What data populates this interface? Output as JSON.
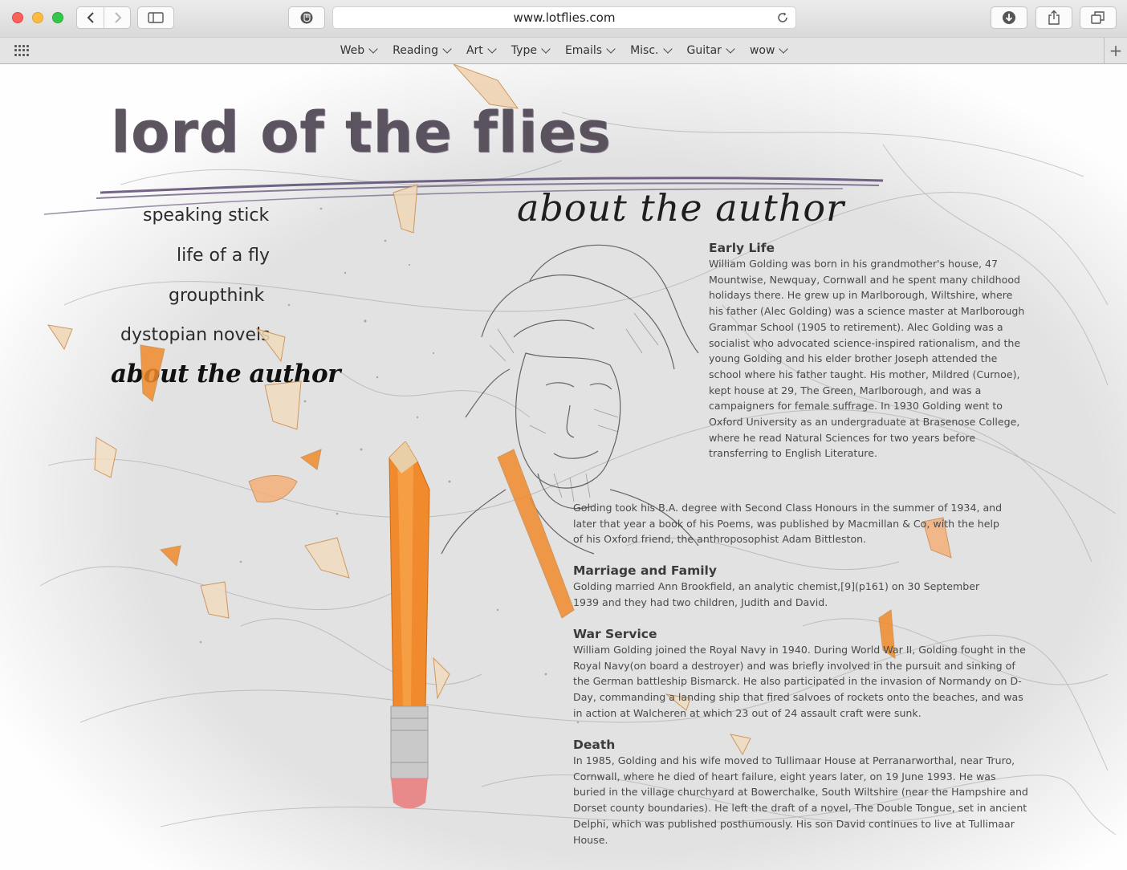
{
  "browser": {
    "url": "www.lotflies.com",
    "favorites": [
      "Web",
      "Reading",
      "Art",
      "Type",
      "Emails",
      "Misc.",
      "Guitar",
      "wow"
    ]
  },
  "site": {
    "title": "lord of the flies",
    "nav": {
      "items": [
        "speaking stick",
        "life of a fly",
        "groupthink",
        "dystopian novels"
      ],
      "active": "about the author"
    },
    "section_heading": "about the author"
  },
  "article": {
    "early_life": {
      "heading": "Early Life",
      "text": "William Golding was born in his grandmother's house, 47 Mountwise, Newquay, Cornwall and he spent many childhood holidays there. He grew up in Marlborough, Wiltshire, where his father (Alec Golding) was a science master at Marlborough Grammar School (1905 to retirement). Alec Golding was a socialist who advocated science-inspired rationalism, and the young Golding and his elder brother Joseph attended the school where his father taught. His mother, Mildred (Curnoe), kept house at 29, The Green, Marlborough, and was a campaigners for female suffrage. In 1930 Golding went to Oxford University as an undergraduate at Brasenose College, where he read Natural Sciences for two years before transferring to English Literature."
    },
    "graduation": {
      "text": "Golding took his B.A. degree with Second Class Honours in the summer of 1934, and later that year a book of his Poems, was published by Macmillan & Co, with the help of his Oxford friend, the anthroposophist Adam Bittleston."
    },
    "marriage": {
      "heading": "Marriage and Family",
      "text": "Golding married Ann Brookfield, an analytic chemist,[9](p161) on 30 September 1939 and they had two children, Judith and David."
    },
    "war_service": {
      "heading": "War Service",
      "text": "William Golding joined the Royal Navy in 1940. During World War II, Golding fought in the Royal Navy(on board a destroyer) and was briefly involved in the pursuit and sinking of the German battleship Bismarck. He also participated in the invasion of Normandy on D-Day, commanding a landing ship that fired salvoes of rockets onto the beaches, and was in action at Walcheren at which 23 out of 24 assault craft were sunk."
    },
    "death": {
      "heading": "Death",
      "text": "In 1985, Golding and his wife moved to Tullimaar House at Perranarworthal, near Truro, Cornwall, where he died of heart failure, eight years later, on 19 June 1993. He was buried in the village churchyard at Bowerchalke, South Wiltshire (near the Hampshire and Dorset county boundaries). He left the draft of a novel, The Double Tongue, set in ancient Delphi, which was published posthumously. His son David continues to live at Tullimaar House."
    }
  },
  "colors": {
    "title": "#4b4350",
    "underline": "#5b4a72",
    "pencil": "#f08a2c",
    "paper": "#e2e2e2"
  },
  "icons": [
    "back-icon",
    "forward-icon",
    "sidebar-icon",
    "extension-icon",
    "reload-icon",
    "download-icon",
    "share-icon",
    "tabs-icon",
    "top-sites-grid-icon",
    "add-bookmark-icon"
  ]
}
